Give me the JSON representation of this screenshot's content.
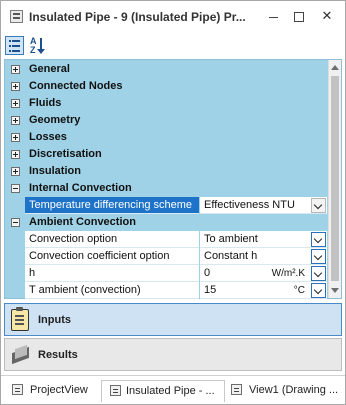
{
  "window": {
    "title": "Insulated Pipe - 9 (Insulated Pipe) Pr...",
    "close_glyph": "✕"
  },
  "toolbar": {
    "categorized_icon": "categorized-icon",
    "alphabetical_icon": "sort-az-icon",
    "alpha_a": "A",
    "alpha_z": "Z"
  },
  "grid": {
    "categories": [
      {
        "label": "General",
        "expanded": false
      },
      {
        "label": "Connected Nodes",
        "expanded": false
      },
      {
        "label": "Fluids",
        "expanded": false
      },
      {
        "label": "Geometry",
        "expanded": false
      },
      {
        "label": "Losses",
        "expanded": false
      },
      {
        "label": "Discretisation",
        "expanded": false
      },
      {
        "label": "Insulation",
        "expanded": false
      },
      {
        "label": "Internal Convection",
        "expanded": true
      },
      {
        "label": "Ambient Convection",
        "expanded": true
      }
    ],
    "internal_convection": [
      {
        "name": "Temperature differencing scheme",
        "value": "Effectiveness NTU",
        "unit": "",
        "selected": true
      }
    ],
    "ambient_convection": [
      {
        "name": "Convection option",
        "value": "To ambient",
        "unit": ""
      },
      {
        "name": "Convection coefficient option",
        "value": "Constant h",
        "unit": ""
      },
      {
        "name": "h",
        "value": "0",
        "unit": "W/m².K"
      },
      {
        "name": "T ambient (convection)",
        "value": "15",
        "unit": "°C"
      }
    ]
  },
  "nav": {
    "inputs_label": "Inputs",
    "results_label": "Results"
  },
  "tabs": [
    {
      "label": "ProjectView"
    },
    {
      "label": "Insulated Pipe - ..."
    },
    {
      "label": "View1 (Drawing ..."
    }
  ],
  "colors": {
    "grid_background": "#9fd2e6",
    "selection": "#1e73c8",
    "inputs_panel": "#cfe2f3"
  }
}
